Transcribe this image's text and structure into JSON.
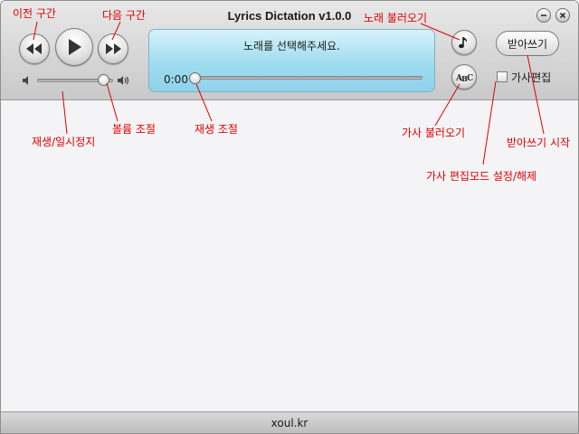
{
  "window": {
    "title": "Lyrics Dictation v1.0.0",
    "minimize_icon": "minimize-icon",
    "close_icon": "close-icon"
  },
  "player": {
    "prev_icon": "rewind-icon",
    "play_icon": "play-icon",
    "next_icon": "fast-forward-icon",
    "volume_level": 0.87,
    "lcd_message": "노래를 선택해주세요.",
    "time": "0:00",
    "seek_position": 0.0
  },
  "right_panel": {
    "load_song_icon": "music-note-icon",
    "load_lyrics_icon": "abc-icon",
    "dictation_button": "받아쓰기",
    "edit_checkbox_label": "가사편집",
    "edit_checked": false
  },
  "footer": {
    "text": "xoul.kr"
  },
  "annotations": {
    "prev": "이전 구간",
    "next": "다음 구간",
    "load_song": "노래 불러오기",
    "play_pause": "재생/일시정지",
    "volume": "볼륨 조절",
    "seek": "재생 조절",
    "load_lyrics": "가사 불러오기",
    "start_dictation": "받아쓰기 시작",
    "edit_mode": "가사 편집모드 설정/해제"
  },
  "colors": {
    "annotation": "#e10000",
    "lcd": "#9fdcf0"
  }
}
